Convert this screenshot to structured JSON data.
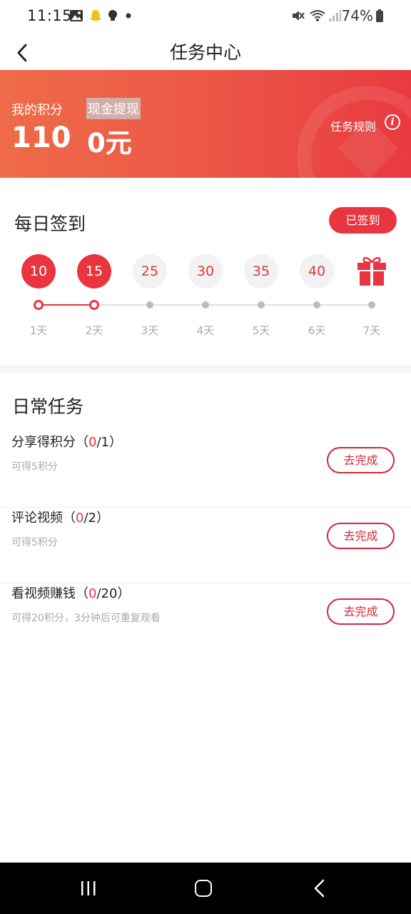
{
  "status_bar": {
    "time": "11:15",
    "battery": "74%"
  },
  "nav": {
    "title": "任务中心"
  },
  "banner": {
    "points_label": "我的积分",
    "points_value": "110",
    "cash_label": "现金提现",
    "cash_value": "0元",
    "rules_label": "任务规则"
  },
  "checkin": {
    "title": "每日签到",
    "status_button": "已签到",
    "days": [
      {
        "reward": "10",
        "label": "1天",
        "done": true
      },
      {
        "reward": "15",
        "label": "2天",
        "done": true
      },
      {
        "reward": "25",
        "label": "3天",
        "done": false
      },
      {
        "reward": "30",
        "label": "4天",
        "done": false
      },
      {
        "reward": "35",
        "label": "5天",
        "done": false
      },
      {
        "reward": "40",
        "label": "6天",
        "done": false
      },
      {
        "reward": "gift-icon",
        "label": "7天",
        "done": false
      }
    ]
  },
  "tasks": {
    "title": "日常任务",
    "items": [
      {
        "name": "分享得积分",
        "done": "0",
        "total": "1",
        "desc": "可得5积分",
        "button": "去完成"
      },
      {
        "name": "评论视频",
        "done": "0",
        "total": "2",
        "desc": "可得5积分",
        "button": "去完成"
      },
      {
        "name": "看视频赚钱",
        "done": "0",
        "total": "20",
        "desc": "可得20积分，3分钟后可重复观看",
        "button": "去完成"
      }
    ]
  },
  "colors": {
    "accent": "#e8353f",
    "banner_start": "#ee6b48",
    "banner_end": "#e83a3f"
  }
}
